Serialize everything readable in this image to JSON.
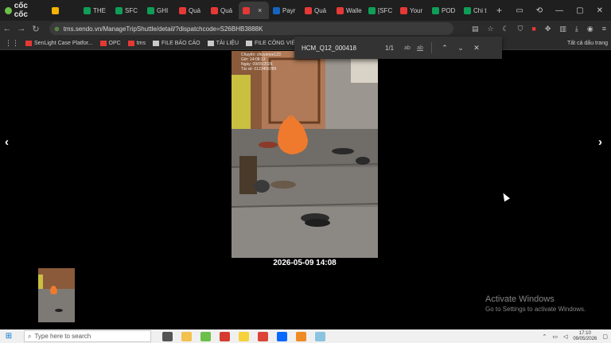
{
  "browser": {
    "brand_name": "cốc cốc",
    "tabs": [
      {
        "label": "",
        "color": "#f4b400"
      },
      {
        "label": "THE",
        "color": "#0f9d58"
      },
      {
        "label": "SFC",
        "color": "#0f9d58"
      },
      {
        "label": "GHI",
        "color": "#0f9d58"
      },
      {
        "label": "Quả",
        "color": "#e53935"
      },
      {
        "label": "Quả",
        "color": "#e53935"
      },
      {
        "label": "",
        "color": "#e53935",
        "active": true
      },
      {
        "label": "Payr",
        "color": "#1565c0"
      },
      {
        "label": "Quả",
        "color": "#e53935"
      },
      {
        "label": "Walle",
        "color": "#e53935"
      },
      {
        "label": "[SFC",
        "color": "#0f9d58"
      },
      {
        "label": "Your",
        "color": "#e53935"
      },
      {
        "label": "POD",
        "color": "#0f9d58"
      },
      {
        "label": "Chi t",
        "color": "#0f9d58"
      }
    ],
    "close_tab_glyph": "×",
    "new_tab_glyph": "+",
    "url": "tms.sendo.vn/ManageTripShuttle/detail/?dispatchcode=S26BHB3888K"
  },
  "bookmarks": {
    "items": [
      {
        "label": "SenLight Case Platfor...",
        "icon": "sendo-icon"
      },
      {
        "label": "OPC",
        "icon": "sendo-icon"
      },
      {
        "label": "tms",
        "icon": "sendo-icon"
      },
      {
        "label": "FILE BÁO CÁO",
        "icon": "folder-icon"
      },
      {
        "label": "TÀI LIỆU",
        "icon": "folder-icon"
      },
      {
        "label": "FILE CÔNG VIỆC",
        "icon": "folder-icon"
      }
    ],
    "all_bookmarks_label": "Tất cả dấu trang"
  },
  "find_bar": {
    "query": "HCM_Q12_000418",
    "count": "1/1",
    "option1": "ab",
    "option2": "ab"
  },
  "viewer": {
    "photo_overlay_lines": [
      "Chuyến: chuyenxe123",
      "Giờ: 14:08:13",
      "Ngày: 09/05/2026",
      "Tài xế: 0123456789"
    ],
    "timestamp": "2026-05-09 14:08",
    "prev_glyph": "‹",
    "next_glyph": "›"
  },
  "watermark": {
    "title": "Activate Windows",
    "subtitle": "Go to Settings to activate Windows."
  },
  "taskbar": {
    "search_placeholder": "Type here to search",
    "apps": [
      {
        "name": "task-view-icon",
        "color": "#555"
      },
      {
        "name": "file-explorer-icon",
        "color": "#f2c14e"
      },
      {
        "name": "coccoc-icon",
        "color": "#6cc04a"
      },
      {
        "name": "wps-icon",
        "color": "#d63b2f"
      },
      {
        "name": "sticky-notes-icon",
        "color": "#f7d23a"
      },
      {
        "name": "chrome-icon",
        "color": "#db4437"
      },
      {
        "name": "zalo-icon",
        "color": "#0a68ff"
      },
      {
        "name": "app-icon",
        "color": "#f08a24"
      },
      {
        "name": "app-icon-2",
        "color": "#8bc4e0"
      }
    ],
    "time": "17:10",
    "date": "09/05/2026"
  }
}
